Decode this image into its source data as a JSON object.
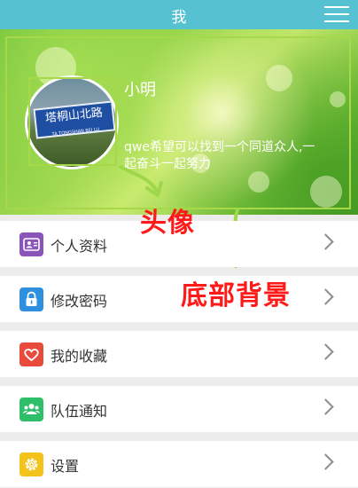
{
  "header": {
    "title": "我",
    "menu_icon": "hamburger-menu-icon"
  },
  "profile": {
    "username": "小明",
    "signature": "qwe希望可以找到一个同道众人,一起奋斗一起努力",
    "avatar_sign_text": "塔桐山北路",
    "avatar_sign_subtext": "TA TONGSHAN BEI LU"
  },
  "annotations": {
    "avatar_label": "头像",
    "background_label": "底部背景",
    "color": "#ff1a1a"
  },
  "menu": {
    "items": [
      {
        "label": "个人资料",
        "icon": "profile-card-icon",
        "color": "#8a55b8"
      },
      {
        "label": "修改密码",
        "icon": "lock-icon",
        "color": "#2d8fdd"
      },
      {
        "label": "我的收藏",
        "icon": "heart-icon",
        "color": "#e84b3c"
      },
      {
        "label": "队伍通知",
        "icon": "team-icon",
        "color": "#2fbf6a"
      },
      {
        "label": "设置",
        "icon": "gear-icon",
        "color": "#f3c21b"
      }
    ]
  }
}
